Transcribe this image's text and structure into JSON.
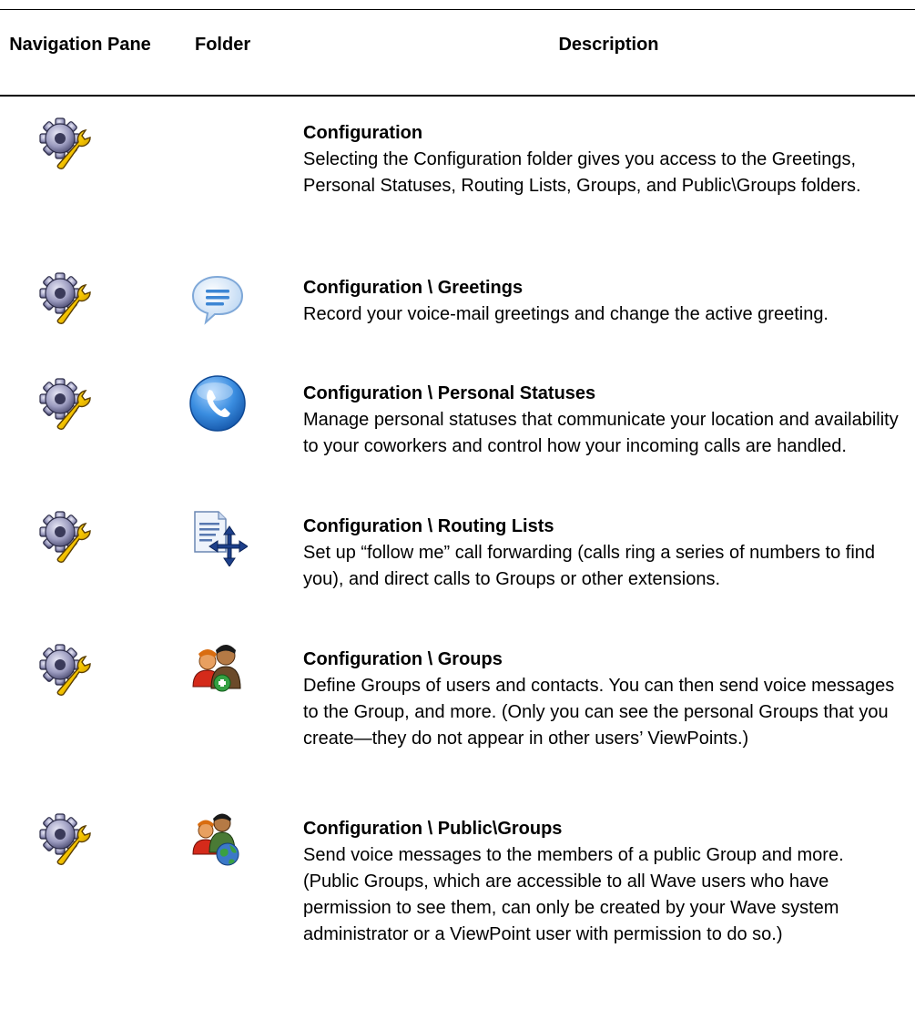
{
  "header": {
    "nav_pane": "Navigation Pane",
    "folder": "Folder",
    "description": "Description"
  },
  "rows": [
    {
      "title": "Configuration",
      "body": "Selecting the Configuration folder gives you access to the Greetings, Personal Statuses, Routing Lists, Groups, and Public\\Groups folders.",
      "nav_icon": "gear-wrench-icon",
      "folder_icon": ""
    },
    {
      "title": "Configuration \\ Greetings",
      "body": "Record your voice-mail greetings and change the active greeting.",
      "nav_icon": "gear-wrench-icon",
      "folder_icon": "speech-bubble-icon"
    },
    {
      "title": "Configuration \\ Personal Statuses",
      "body": "Manage personal statuses that communicate your location and availability to your coworkers and control how your incoming calls are handled.",
      "nav_icon": "gear-wrench-icon",
      "folder_icon": "phone-circle-icon"
    },
    {
      "title": "Configuration \\ Routing Lists",
      "body": "Set up “follow me” call forwarding (calls ring a series of numbers to find you), and direct calls to Groups or other extensions.",
      "nav_icon": "gear-wrench-icon",
      "folder_icon": "document-move-icon"
    },
    {
      "title": "Configuration \\ Groups",
      "body": "Define Groups of users and contacts. You can then send voice messages to the Group, and more. (Only you can see the personal Groups that you create—they do not appear in other users’ ViewPoints.)",
      "nav_icon": "gear-wrench-icon",
      "folder_icon": "people-group-icon"
    },
    {
      "title": "Configuration \\ Public\\Groups",
      "body": "Send voice messages to the members of a public Group and more. (Public Groups, which are accessible to all Wave users who have permission to see them, can only be created by your Wave system administrator or a ViewPoint user with permission to do so.)",
      "nav_icon": "gear-wrench-icon",
      "folder_icon": "public-group-icon"
    }
  ]
}
